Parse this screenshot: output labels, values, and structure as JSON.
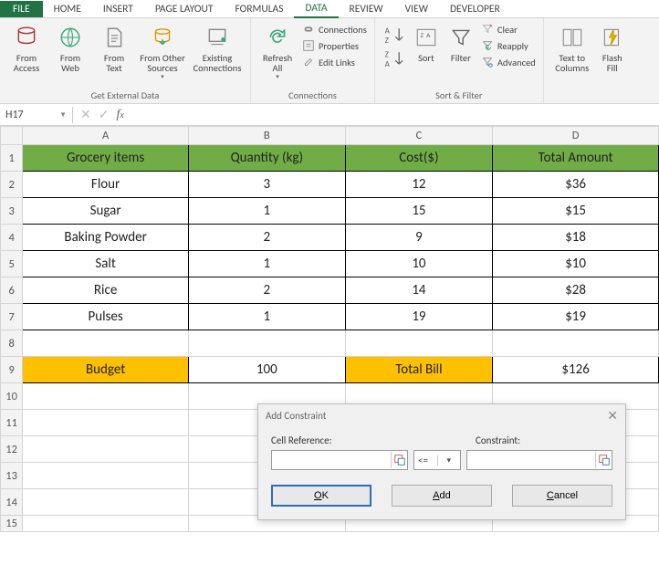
{
  "tabs": {
    "file": "FILE",
    "home": "HOME",
    "insert": "INSERT",
    "pageLayout": "PAGE LAYOUT",
    "formulas": "FORMULAS",
    "data": "DATA",
    "review": "REVIEW",
    "view": "VIEW",
    "developer": "DEVELOPER"
  },
  "ribbon": {
    "fromAccess": "From\nAccess",
    "fromWeb": "From\nWeb",
    "fromText": "From\nText",
    "fromOther": "From Other\nSources",
    "existing": "Existing\nConnections",
    "refresh": "Refresh\nAll",
    "connections": "Connections",
    "properties": "Properties",
    "editLinks": "Edit Links",
    "sort": "Sort",
    "filter": "Filter",
    "clear": "Clear",
    "reapply": "Reapply",
    "advanced": "Advanced",
    "textToCols": "Text to\nColumns",
    "flashFill": "Flash\nFill",
    "grpExternal": "Get External Data",
    "grpConn": "Connections",
    "grpSort": "Sort & Filter"
  },
  "namebox": "H17",
  "columns": [
    "A",
    "B",
    "C",
    "D"
  ],
  "rows": [
    "1",
    "2",
    "3",
    "4",
    "5",
    "6",
    "7",
    "8",
    "9",
    "10",
    "11",
    "12",
    "13",
    "14",
    "15"
  ],
  "header": {
    "a": "Grocery items",
    "b": "Quantity (kg)",
    "c": "Cost($)",
    "d": "Total Amount"
  },
  "data": [
    {
      "a": "Flour",
      "b": "3",
      "c": "12",
      "d": "$36"
    },
    {
      "a": "Sugar",
      "b": "1",
      "c": "15",
      "d": "$15"
    },
    {
      "a": "Baking Powder",
      "b": "2",
      "c": "9",
      "d": "$18"
    },
    {
      "a": "Salt",
      "b": "1",
      "c": "10",
      "d": "$10"
    },
    {
      "a": "Rice",
      "b": "2",
      "c": "14",
      "d": "$28"
    },
    {
      "a": "Pulses",
      "b": "1",
      "c": "19",
      "d": "$19"
    }
  ],
  "summary": {
    "a": "Budget",
    "b": "100",
    "c": "Total Bill",
    "d": "$126"
  },
  "dialog": {
    "title": "Add Constraint",
    "cellRef": "Cell Reference:",
    "constraint": "Constraint:",
    "op": "<=",
    "ok": "OK",
    "add": "Add",
    "cancel": "Cancel"
  }
}
